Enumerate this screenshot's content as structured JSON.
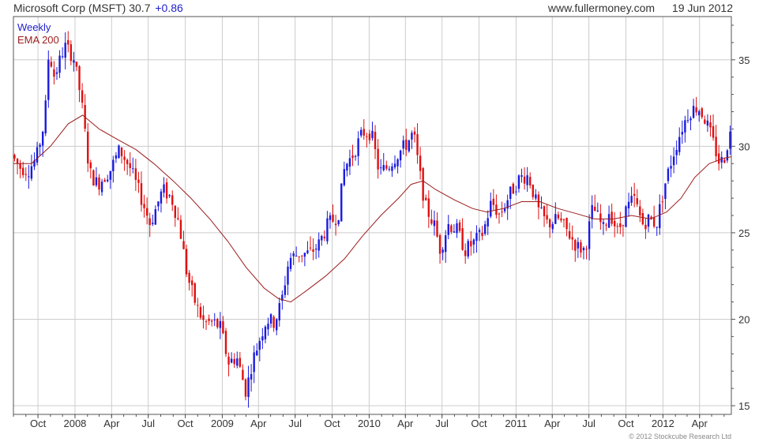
{
  "header": {
    "symbol_label": "Microsoft Corp (MSFT)",
    "last_price": "30.7",
    "change": "+0.86",
    "source": "www.fullermoney.com",
    "date": "19 Jun 2012"
  },
  "legend": {
    "period": "Weekly",
    "ema_label": "EMA 200"
  },
  "footer": {
    "copyright": "© 2012 Stockcube Research Ltd"
  },
  "colors": {
    "up_candle": "#1a1adf",
    "down_candle": "#e01010",
    "ema_line": "#9b1c1c",
    "grid": "#cccccc",
    "axis": "#555555"
  },
  "chart_data": {
    "type": "candlestick",
    "period": "weekly",
    "x_range": [
      "2007-08-01",
      "2012-06-19"
    ],
    "ylim": [
      14.5,
      37.5
    ],
    "y_scale": "linear",
    "y_ticks": [
      15,
      20,
      25,
      30,
      35
    ],
    "y_axis_side": "right",
    "grid": true,
    "x_ticks": [
      {
        "label": "Oct",
        "date": "2007-10-01"
      },
      {
        "label": "2008",
        "date": "2008-01-01"
      },
      {
        "label": "Apr",
        "date": "2008-04-01"
      },
      {
        "label": "Jul",
        "date": "2008-07-01"
      },
      {
        "label": "Oct",
        "date": "2008-10-01"
      },
      {
        "label": "2009",
        "date": "2009-01-01"
      },
      {
        "label": "Apr",
        "date": "2009-04-01"
      },
      {
        "label": "Jul",
        "date": "2009-07-01"
      },
      {
        "label": "Oct",
        "date": "2009-10-01"
      },
      {
        "label": "2010",
        "date": "2010-01-01"
      },
      {
        "label": "Apr",
        "date": "2010-04-01"
      },
      {
        "label": "Jul",
        "date": "2010-07-01"
      },
      {
        "label": "Oct",
        "date": "2010-10-01"
      },
      {
        "label": "2011",
        "date": "2011-01-01"
      },
      {
        "label": "Apr",
        "date": "2011-04-01"
      },
      {
        "label": "Jul",
        "date": "2011-07-01"
      },
      {
        "label": "Oct",
        "date": "2011-10-01"
      },
      {
        "label": "2012",
        "date": "2012-01-01"
      },
      {
        "label": "Apr",
        "date": "2012-04-01"
      }
    ],
    "price_path": [
      [
        "2007-08-01",
        29.5
      ],
      [
        "2007-08-20",
        28.8
      ],
      [
        "2007-09-10",
        28.6
      ],
      [
        "2007-10-01",
        29.3
      ],
      [
        "2007-10-22",
        31.5
      ],
      [
        "2007-11-01",
        35.5
      ],
      [
        "2007-11-15",
        34.0
      ],
      [
        "2007-12-10",
        35.8
      ],
      [
        "2008-01-01",
        35.2
      ],
      [
        "2008-01-20",
        32.8
      ],
      [
        "2008-02-10",
        28.5
      ],
      [
        "2008-03-01",
        27.8
      ],
      [
        "2008-04-01",
        28.6
      ],
      [
        "2008-04-25",
        29.8
      ],
      [
        "2008-05-20",
        28.8
      ],
      [
        "2008-06-15",
        27.2
      ],
      [
        "2008-07-10",
        25.5
      ],
      [
        "2008-08-10",
        27.5
      ],
      [
        "2008-09-01",
        27.0
      ],
      [
        "2008-09-20",
        25.5
      ],
      [
        "2008-10-10",
        22.5
      ],
      [
        "2008-11-01",
        20.8
      ],
      [
        "2008-11-20",
        19.8
      ],
      [
        "2008-12-15",
        19.8
      ],
      [
        "2009-01-01",
        19.5
      ],
      [
        "2009-01-20",
        17.5
      ],
      [
        "2009-02-10",
        17.8
      ],
      [
        "2009-03-05",
        15.8
      ],
      [
        "2009-03-20",
        17.5
      ],
      [
        "2009-04-10",
        19.0
      ],
      [
        "2009-04-25",
        20.0
      ],
      [
        "2009-05-15",
        19.8
      ],
      [
        "2009-06-01",
        21.0
      ],
      [
        "2009-06-20",
        23.5
      ],
      [
        "2009-07-15",
        23.8
      ],
      [
        "2009-08-10",
        23.8
      ],
      [
        "2009-09-01",
        24.3
      ],
      [
        "2009-09-25",
        25.5
      ],
      [
        "2009-10-20",
        26.0
      ],
      [
        "2009-11-05",
        28.8
      ],
      [
        "2009-11-25",
        29.5
      ],
      [
        "2009-12-20",
        30.8
      ],
      [
        "2010-01-10",
        30.8
      ],
      [
        "2010-01-30",
        28.5
      ],
      [
        "2010-02-20",
        28.8
      ],
      [
        "2010-03-15",
        29.5
      ],
      [
        "2010-04-10",
        30.2
      ],
      [
        "2010-04-25",
        30.8
      ],
      [
        "2010-05-10",
        28.5
      ],
      [
        "2010-05-25",
        26.5
      ],
      [
        "2010-06-15",
        25.5
      ],
      [
        "2010-07-01",
        24.0
      ],
      [
        "2010-07-20",
        25.5
      ],
      [
        "2010-08-10",
        25.2
      ],
      [
        "2010-09-01",
        24.0
      ],
      [
        "2010-09-25",
        24.5
      ],
      [
        "2010-10-15",
        25.0
      ],
      [
        "2010-11-05",
        26.8
      ],
      [
        "2010-11-25",
        26.0
      ],
      [
        "2010-12-20",
        27.2
      ],
      [
        "2011-01-15",
        28.2
      ],
      [
        "2011-02-05",
        28.3
      ],
      [
        "2011-03-01",
        26.3
      ],
      [
        "2011-03-25",
        25.5
      ],
      [
        "2011-04-20",
        25.8
      ],
      [
        "2011-05-15",
        25.0
      ],
      [
        "2011-06-05",
        24.2
      ],
      [
        "2011-06-25",
        24.0
      ],
      [
        "2011-07-15",
        26.5
      ],
      [
        "2011-08-10",
        25.2
      ],
      [
        "2011-08-25",
        26.3
      ],
      [
        "2011-09-15",
        25.0
      ],
      [
        "2011-10-05",
        26.3
      ],
      [
        "2011-10-25",
        27.0
      ],
      [
        "2011-11-15",
        25.5
      ],
      [
        "2011-12-01",
        25.8
      ],
      [
        "2011-12-20",
        25.5
      ],
      [
        "2012-01-10",
        27.8
      ],
      [
        "2012-01-30",
        29.5
      ],
      [
        "2012-02-20",
        31.0
      ],
      [
        "2012-03-10",
        32.0
      ],
      [
        "2012-04-01",
        32.3
      ],
      [
        "2012-04-20",
        31.5
      ],
      [
        "2012-05-05",
        30.5
      ],
      [
        "2012-05-25",
        29.0
      ],
      [
        "2012-06-05",
        29.3
      ],
      [
        "2012-06-19",
        30.7
      ]
    ],
    "ema200_path": [
      [
        "2007-08-01",
        29.0
      ],
      [
        "2007-09-15",
        29.0
      ],
      [
        "2007-11-01",
        30.0
      ],
      [
        "2007-12-15",
        31.3
      ],
      [
        "2008-01-20",
        31.8
      ],
      [
        "2008-03-01",
        31.0
      ],
      [
        "2008-04-15",
        30.4
      ],
      [
        "2008-06-01",
        29.8
      ],
      [
        "2008-07-15",
        29.0
      ],
      [
        "2008-09-01",
        28.0
      ],
      [
        "2008-10-15",
        27.0
      ],
      [
        "2008-12-01",
        25.8
      ],
      [
        "2009-01-15",
        24.5
      ],
      [
        "2009-03-01",
        23.0
      ],
      [
        "2009-04-15",
        21.8
      ],
      [
        "2009-05-20",
        21.2
      ],
      [
        "2009-06-20",
        21.0
      ],
      [
        "2009-08-01",
        21.7
      ],
      [
        "2009-09-15",
        22.5
      ],
      [
        "2009-11-01",
        23.5
      ],
      [
        "2009-12-15",
        24.8
      ],
      [
        "2010-01-30",
        26.0
      ],
      [
        "2010-03-15",
        27.0
      ],
      [
        "2010-04-15",
        27.8
      ],
      [
        "2010-05-15",
        28.0
      ],
      [
        "2010-06-15",
        27.5
      ],
      [
        "2010-08-01",
        26.9
      ],
      [
        "2010-09-15",
        26.4
      ],
      [
        "2010-10-20",
        26.2
      ],
      [
        "2010-12-01",
        26.4
      ],
      [
        "2011-01-15",
        26.8
      ],
      [
        "2011-03-01",
        26.8
      ],
      [
        "2011-04-15",
        26.4
      ],
      [
        "2011-06-01",
        26.1
      ],
      [
        "2011-07-15",
        25.8
      ],
      [
        "2011-09-01",
        25.8
      ],
      [
        "2011-10-15",
        26.0
      ],
      [
        "2011-12-01",
        25.8
      ],
      [
        "2012-01-10",
        26.2
      ],
      [
        "2012-02-15",
        27.0
      ],
      [
        "2012-03-20",
        28.2
      ],
      [
        "2012-04-25",
        29.0
      ],
      [
        "2012-05-30",
        29.3
      ],
      [
        "2012-06-19",
        29.4
      ]
    ]
  }
}
